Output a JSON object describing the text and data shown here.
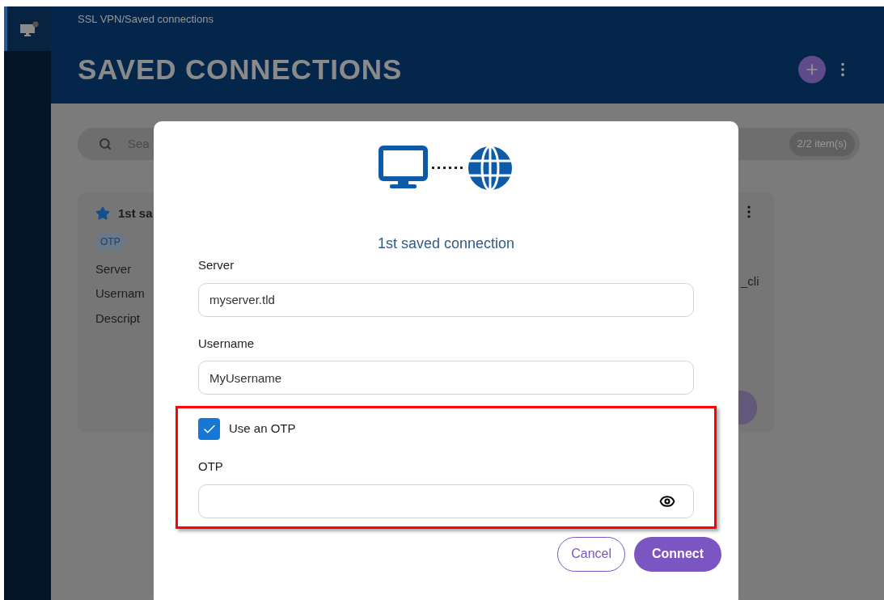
{
  "breadcrumb": "SSL VPN/Saved connections",
  "page_title": "SAVED CONNECTIONS",
  "search": {
    "placeholder": "Sea",
    "count": "2/2 item(s)"
  },
  "card": {
    "favorite": true,
    "title": "1st sa",
    "tag": "OTP",
    "fields": [
      "Server",
      "Usernam",
      "Descript"
    ],
    "value_fragment": "_cli"
  },
  "dialog": {
    "title": "1st saved connection",
    "fields": [
      {
        "label": "Server",
        "value": "myserver.tld"
      },
      {
        "label": "Username",
        "value": "MyUsername"
      }
    ],
    "use_otp": {
      "label": "Use an OTP",
      "checked": true
    },
    "otp": {
      "label": "OTP"
    },
    "buttons": [
      {
        "label": "Cancel",
        "kind": "secondary"
      },
      {
        "label": "Connect",
        "kind": "primary"
      }
    ]
  }
}
